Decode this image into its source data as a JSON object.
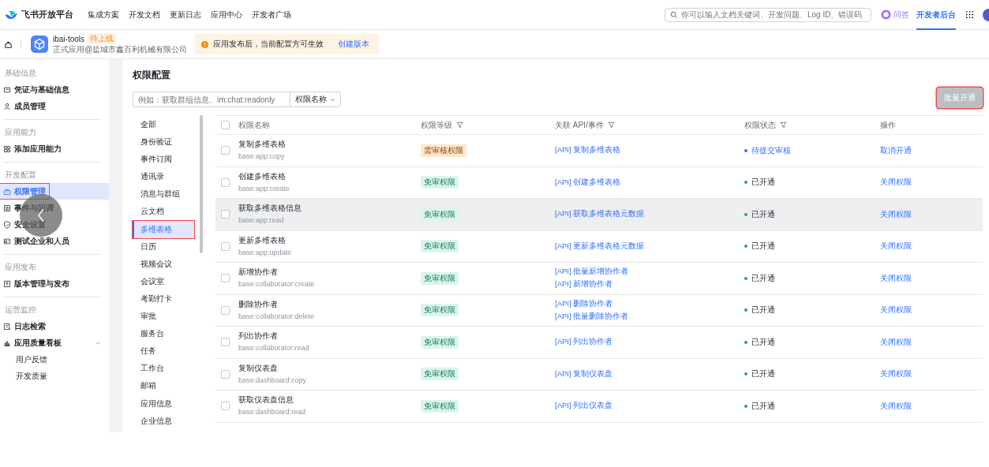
{
  "topbar": {
    "brand": "飞书开放平台",
    "nav": [
      "集成方案",
      "开发文档",
      "更新日志",
      "应用中心",
      "开发者广场"
    ],
    "search": {
      "placeholder": "你可以输入文档关键词、开发问题、Log ID、错误码"
    },
    "qa": "问答",
    "console": {
      "label": "开发者后台",
      "selected": true
    }
  },
  "app": {
    "name": "ibai-tools",
    "tag": "待上线",
    "subtitle": "正式应用@盐城市鑫百利机械有限公司",
    "notice": "应用发布后，当前配置方可生效",
    "notice_link": "创建版本"
  },
  "sidebar": [
    {
      "title": "基础信息",
      "items": [
        {
          "label": "凭证与基础信息",
          "selected": false,
          "outlined": false
        },
        {
          "label": "成员管理",
          "selected": false,
          "outlined": false
        }
      ]
    },
    {
      "title": "应用能力",
      "items": [
        {
          "label": "添加应用能力",
          "selected": false,
          "outlined": false
        }
      ]
    },
    {
      "title": "开发配置",
      "items": [
        {
          "label": "权限管理",
          "selected": true,
          "outlined": true
        },
        {
          "label": "事件与回调",
          "selected": false,
          "outlined": false
        },
        {
          "label": "安全设置",
          "selected": false,
          "outlined": false
        },
        {
          "label": "测试企业和人员",
          "selected": false,
          "outlined": false
        }
      ]
    },
    {
      "title": "应用发布",
      "items": [
        {
          "label": "版本管理与发布",
          "selected": false,
          "outlined": false
        }
      ]
    },
    {
      "title": "运营监控",
      "items": [
        {
          "label": "日志检索",
          "selected": false,
          "outlined": false
        },
        {
          "label": "应用质量看板",
          "selected": false,
          "outlined": false,
          "expanded": true,
          "children": [
            {
              "label": "用户反馈",
              "selected": false
            },
            {
              "label": "开发质量",
              "selected": false
            }
          ]
        }
      ]
    }
  ],
  "page_title": "权限配置",
  "filter": {
    "placeholder": "例如：获取群组信息、im:chat:readonly",
    "select": "权限名称"
  },
  "bulk_button": {
    "label": "批量开通",
    "disabled": true,
    "outlined": true
  },
  "categories": [
    {
      "label": "全部",
      "selected": false,
      "outlined": false
    },
    {
      "label": "身份验证",
      "selected": false,
      "outlined": false
    },
    {
      "label": "事件订阅",
      "selected": false,
      "outlined": false
    },
    {
      "label": "通讯录",
      "selected": false,
      "outlined": false
    },
    {
      "label": "消息与群组",
      "selected": false,
      "outlined": false
    },
    {
      "label": "云文档",
      "selected": false,
      "outlined": false
    },
    {
      "label": "多维表格",
      "selected": true,
      "outlined": true
    },
    {
      "label": "日历",
      "selected": false,
      "outlined": false
    },
    {
      "label": "视频会议",
      "selected": false,
      "outlined": false
    },
    {
      "label": "会议室",
      "selected": false,
      "outlined": false
    },
    {
      "label": "考勤打卡",
      "selected": false,
      "outlined": false
    },
    {
      "label": "审批",
      "selected": false,
      "outlined": false
    },
    {
      "label": "服务台",
      "selected": false,
      "outlined": false
    },
    {
      "label": "任务",
      "selected": false,
      "outlined": false
    },
    {
      "label": "工作台",
      "selected": false,
      "outlined": false
    },
    {
      "label": "邮箱",
      "selected": false,
      "outlined": false
    },
    {
      "label": "应用信息",
      "selected": false,
      "outlined": false
    },
    {
      "label": "企业信息",
      "selected": false,
      "outlined": false
    }
  ],
  "table": {
    "select_all": {
      "checked": false
    },
    "columns": [
      "权限名称",
      "权限等级",
      "关联 API/事件",
      "权限状态",
      "操作"
    ],
    "rows": [
      {
        "checked": false,
        "highlighted": false,
        "name": "复制多维表格",
        "scope": "base:app:copy",
        "level": {
          "kind": "review",
          "label": "需审核权限"
        },
        "apis": [
          "[API] 复制多维表格"
        ],
        "status": {
          "kind": "pending",
          "label": "待提交审核"
        },
        "action": "取消开通"
      },
      {
        "checked": false,
        "highlighted": false,
        "name": "创建多维表格",
        "scope": "base:app:create",
        "level": {
          "kind": "free",
          "label": "免审权限"
        },
        "apis": [
          "[API] 创建多维表格"
        ],
        "status": {
          "kind": "enabled",
          "label": "已开通"
        },
        "action": "关闭权限"
      },
      {
        "checked": false,
        "highlighted": true,
        "name": "获取多维表格信息",
        "scope": "base:app:read",
        "level": {
          "kind": "free",
          "label": "免审权限"
        },
        "apis": [
          "[API] 获取多维表格元数据"
        ],
        "status": {
          "kind": "enabled",
          "label": "已开通"
        },
        "action": "关闭权限"
      },
      {
        "checked": false,
        "highlighted": false,
        "name": "更新多维表格",
        "scope": "base:app:update",
        "level": {
          "kind": "free",
          "label": "免审权限"
        },
        "apis": [
          "[API] 更新多维表格元数据"
        ],
        "status": {
          "kind": "enabled",
          "label": "已开通"
        },
        "action": "关闭权限"
      },
      {
        "checked": false,
        "highlighted": false,
        "name": "新增协作者",
        "scope": "base:collaborator:create",
        "level": {
          "kind": "free",
          "label": "免审权限"
        },
        "apis": [
          "[API] 批量新增协作者",
          "[API] 新增协作者"
        ],
        "status": {
          "kind": "enabled",
          "label": "已开通"
        },
        "action": "关闭权限"
      },
      {
        "checked": false,
        "highlighted": false,
        "name": "删除协作者",
        "scope": "base:collaborator:delete",
        "level": {
          "kind": "free",
          "label": "免审权限"
        },
        "apis": [
          "[API] 删除协作者",
          "[API] 批量删除协作者"
        ],
        "status": {
          "kind": "enabled",
          "label": "已开通"
        },
        "action": "关闭权限"
      },
      {
        "checked": false,
        "highlighted": false,
        "name": "列出协作者",
        "scope": "base:collaborator:read",
        "level": {
          "kind": "free",
          "label": "免审权限"
        },
        "apis": [
          "[API] 列出协作者"
        ],
        "status": {
          "kind": "enabled",
          "label": "已开通"
        },
        "action": "关闭权限"
      },
      {
        "checked": false,
        "highlighted": false,
        "name": "复制仪表盘",
        "scope": "base:dashboard:copy",
        "level": {
          "kind": "free",
          "label": "免审权限"
        },
        "apis": [
          "[API] 复制仪表盘"
        ],
        "status": {
          "kind": "enabled",
          "label": "已开通"
        },
        "action": "关闭权限"
      },
      {
        "checked": false,
        "highlighted": false,
        "name": "获取仪表盘信息",
        "scope": "base:dashboard:read",
        "level": {
          "kind": "free",
          "label": "免审权限"
        },
        "apis": [
          "[API] 列出仪表盘"
        ],
        "status": {
          "kind": "enabled",
          "label": "已开通"
        },
        "action": "关闭权限"
      }
    ]
  }
}
